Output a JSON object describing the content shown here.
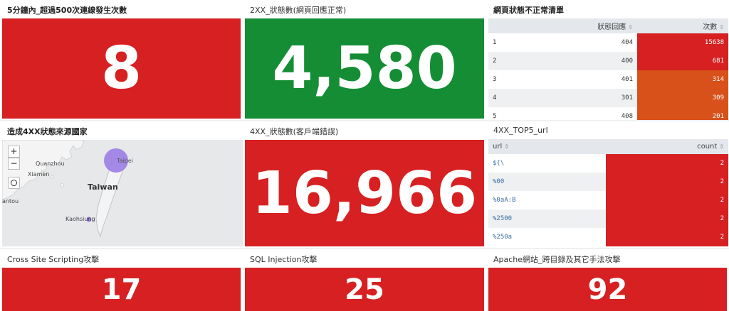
{
  "colors": {
    "red": "#d62021",
    "green": "#148d34",
    "orange": "#d8511b",
    "bubble": "#9b7de6"
  },
  "panels": {
    "p1": {
      "title": "5分鐘內_超過500次連線發生次數",
      "value": "8"
    },
    "p2": {
      "title": "2XX_狀態數(網頁回應正常)",
      "value": "4,580"
    },
    "p3": {
      "title": "網頁狀態不正常清單",
      "columns": [
        "",
        "狀態回應",
        "次數"
      ],
      "rows": [
        {
          "index": "1",
          "status": "404",
          "count": "15638",
          "level": "red"
        },
        {
          "index": "2",
          "status": "400",
          "count": "681",
          "level": "red"
        },
        {
          "index": "3",
          "status": "401",
          "count": "314",
          "level": "orange"
        },
        {
          "index": "4",
          "status": "301",
          "count": "309",
          "level": "orange"
        },
        {
          "index": "5",
          "status": "408",
          "count": "201",
          "level": "orange"
        }
      ]
    },
    "p4": {
      "title": "造成4XX狀態來源國家",
      "zoom_in": "+",
      "zoom_out": "−",
      "labels": {
        "quanzhou": "Quanzhou",
        "xiamen": "Xiamen",
        "taiwan": "Taiwan",
        "taipei": "Taipei",
        "kaohsiung": "Kaohsiung",
        "antou": "antou"
      }
    },
    "p5": {
      "title": "4XX_狀態數(客戶端錯誤)",
      "value": "16,966"
    },
    "p6": {
      "title": "4XX_TOP5_url",
      "columns": [
        "url",
        "count"
      ],
      "rows": [
        {
          "url": "${\\",
          "count": "2"
        },
        {
          "url": "%00",
          "count": "2"
        },
        {
          "url": "%0aA:B",
          "count": "2"
        },
        {
          "url": "%2500",
          "count": "2"
        },
        {
          "url": "%250a",
          "count": "2"
        }
      ]
    },
    "p7": {
      "title": "Cross Site Scripting攻擊",
      "value": "17"
    },
    "p8": {
      "title": "SQL Injection攻擊",
      "value": "25"
    },
    "p9": {
      "title": "Apache網站_跨目錄及其它手法攻擊",
      "value": "92"
    }
  }
}
